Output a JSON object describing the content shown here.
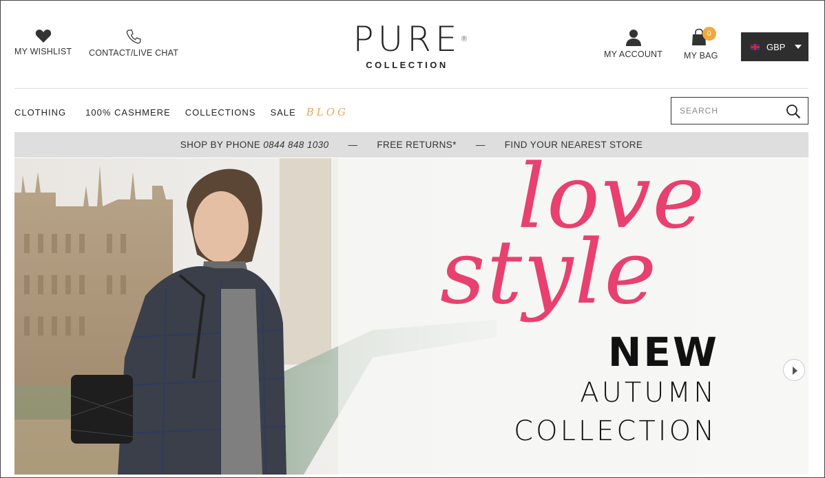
{
  "header": {
    "wishlist_label": "MY WISHLIST",
    "contact_label": "CONTACT/LIVE CHAT",
    "logo_main": "PURE",
    "logo_reg": "®",
    "logo_sub": "COLLECTION",
    "account_label": "MY ACCOUNT",
    "bag_label": "MY BAG",
    "bag_count": "0",
    "currency": "GBP"
  },
  "nav": {
    "items": [
      "CLOTHING",
      "100% CASHMERE",
      "COLLECTIONS",
      "SALE"
    ],
    "blog": "BLOG"
  },
  "search": {
    "placeholder": "SEARCH"
  },
  "promo": {
    "phone_label": "SHOP BY PHONE",
    "phone_number": "0844 848 1030",
    "returns": "FREE RETURNS*",
    "store": "FIND YOUR NEAREST STORE",
    "separator": "—"
  },
  "hero": {
    "script_line1": "love",
    "script_line2": "style",
    "headline": "NEW",
    "line2": "AUTUMN",
    "line3": "COLLECTION"
  },
  "colors": {
    "accent_pink": "#e8406f",
    "badge_orange": "#f0a93b",
    "blog_gold": "#e3a95a",
    "dark": "#2e2e2e"
  }
}
